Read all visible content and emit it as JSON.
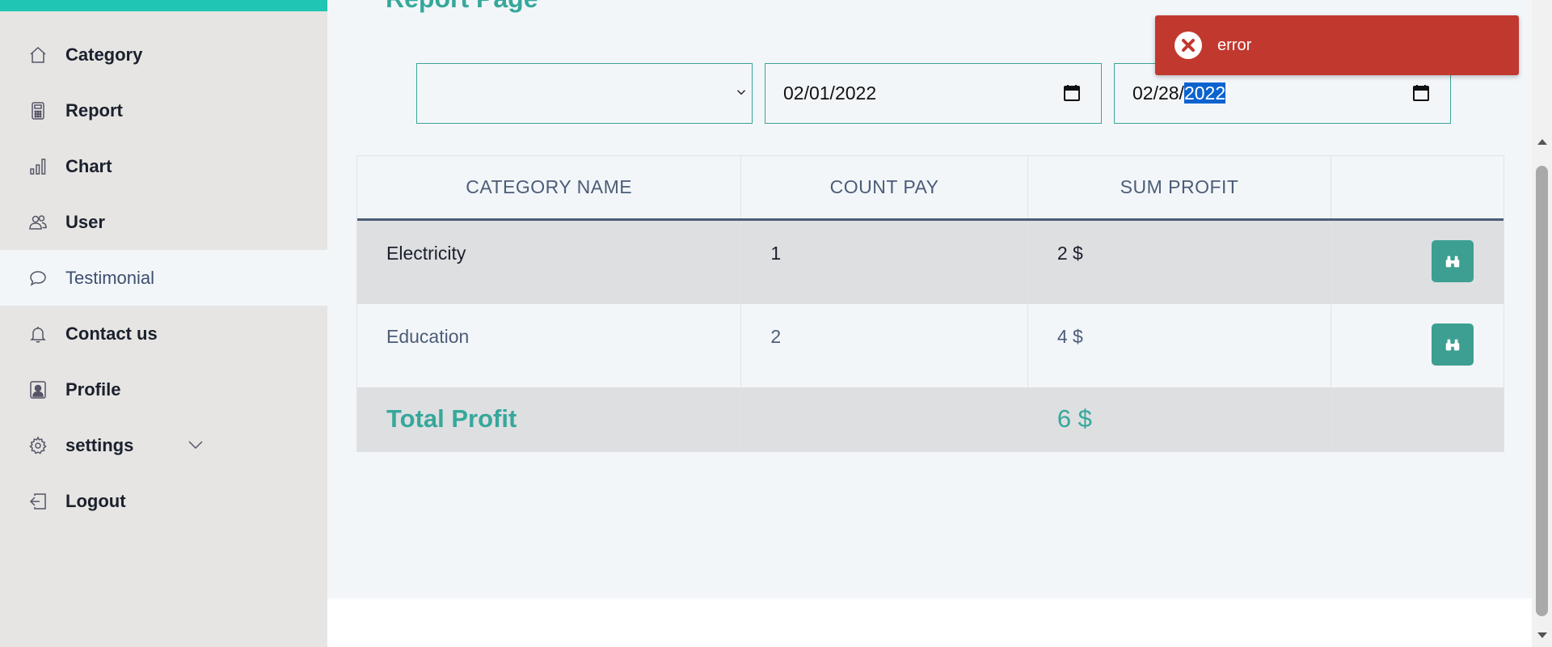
{
  "sidebar": {
    "items": [
      {
        "label": "Category",
        "icon": "home-icon"
      },
      {
        "label": "Report",
        "icon": "calculator-icon"
      },
      {
        "label": "Chart",
        "icon": "bar-chart-icon"
      },
      {
        "label": "User",
        "icon": "users-icon"
      },
      {
        "label": "Testimonial",
        "icon": "chat-bubble-icon",
        "active": true
      },
      {
        "label": "Contact us",
        "icon": "bell-icon"
      },
      {
        "label": "Profile",
        "icon": "person-badge-icon"
      },
      {
        "label": "settings",
        "icon": "gear-icon",
        "expandable": true
      },
      {
        "label": "Logout",
        "icon": "logout-icon"
      }
    ],
    "accent": "#20c5b4"
  },
  "main": {
    "title": "Report Page",
    "filters": {
      "category_select": "",
      "date_from": "02/01/2022",
      "date_to_prefix": "02/28/",
      "date_to_selected": "2022"
    },
    "table": {
      "headers": [
        "CATEGORY NAME",
        "COUNT PAY",
        "SUM PROFIT",
        ""
      ],
      "rows": [
        {
          "category": "Electricity",
          "count": "1",
          "profit": "2 $",
          "action_icon": "binoculars-icon"
        },
        {
          "category": "Education",
          "count": "2",
          "profit": "4 $",
          "action_icon": "binoculars-icon"
        }
      ],
      "footer": {
        "label": "Total Profit",
        "total": "6 $"
      }
    }
  },
  "toast": {
    "message": "error",
    "icon": "error-circle-icon",
    "color": "#c1382f"
  },
  "colors": {
    "accent_teal": "#35a89b",
    "button_teal": "#3d9f91",
    "header_text": "#4b5d78"
  }
}
